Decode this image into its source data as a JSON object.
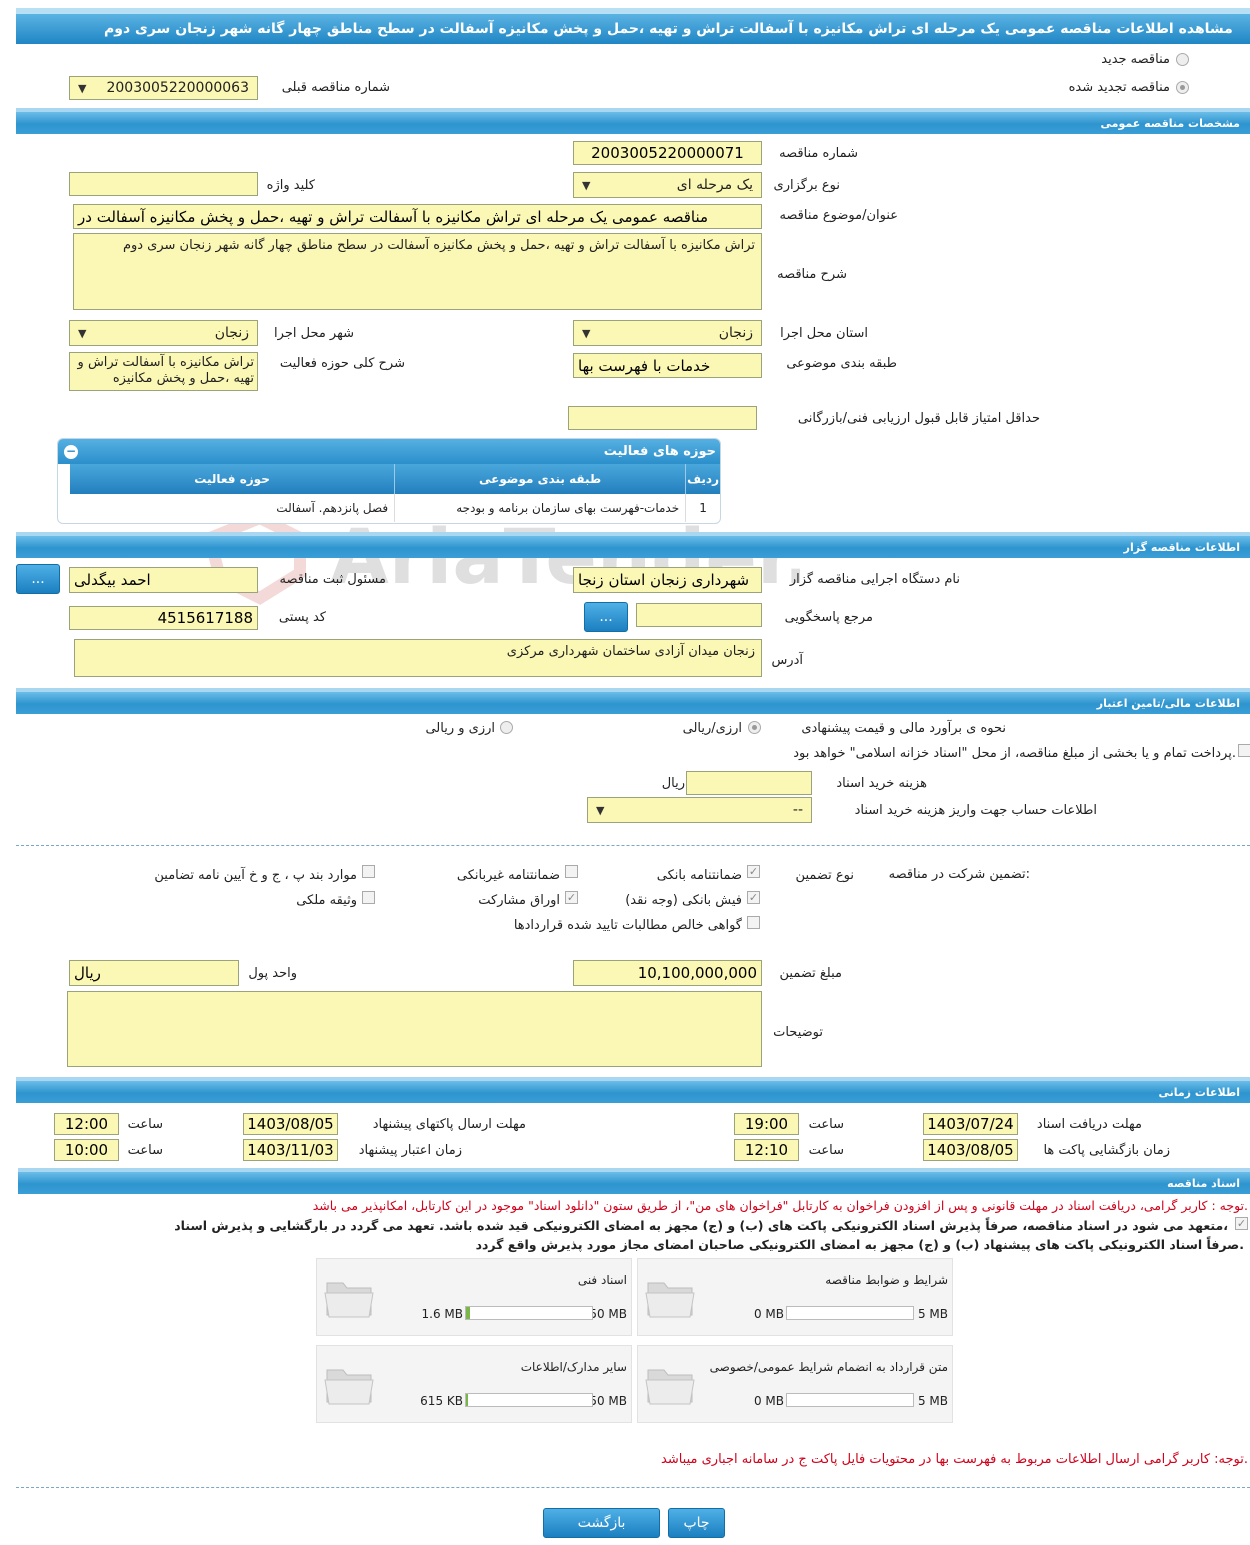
{
  "header": {
    "title": "مشاهده اطلاعات مناقصه عمومی یک مرحله ای تراش مکانیزه با آسفالت تراش و تهیه ،حمل و پخش مکانیزه آسفالت در سطح مناطق چهار گانه شهر زنجان سری دوم"
  },
  "top": {
    "radio_new": "مناقصه جدید",
    "radio_renewed": "مناقصه تجدید شده",
    "prev_number_label": "شماره مناقصه قبلی",
    "prev_number_value": "2003005220000063"
  },
  "general": {
    "section_title": "مشخصات مناقصه عمومی",
    "number_label": "شماره مناقصه",
    "number_value": "2003005220000071",
    "type_label": "نوع برگزاری",
    "type_value": "یک مرحله ای",
    "keyword_label": "کلید واژه",
    "keyword_value": "",
    "subject_label": "عنوان/موضوع مناقصه",
    "subject_value": "مناقصه عمومی یک مرحله ای تراش مکانیزه با آسفالت تراش و تهیه ،حمل و پخش مکانیزه آسفالت در",
    "desc_label": "شرح مناقصه",
    "desc_value": "تراش مکانیزه با آسفالت تراش و تهیه ،حمل و پخش مکانیزه آسفالت در سطح مناطق چهار گانه شهر زنجان سری دوم",
    "province_label": "استان محل اجرا",
    "province_value": "زنجان",
    "city_label": "شهر محل اجرا",
    "city_value": "زنجان",
    "category_label": "طبقه بندی موضوعی",
    "category_value": "خدمات با فهرست بها",
    "scope_label": "شرح کلی حوزه فعالیت",
    "scope_value": "تراش مکانیزه با آسفالت تراش و تهیه ،حمل و پخش مکانیزه",
    "min_score_label": "حداقل امتیاز قابل قبول ارزیابی فنی/بازرگانی",
    "min_score_value": ""
  },
  "activity_table": {
    "title": "حوزه های فعالیت",
    "headers": [
      "ردیف",
      "طبقه بندی موضوعی",
      "حوزه فعالیت"
    ],
    "rows": [
      [
        "1",
        "خدمات-فهرست بهای سازمان برنامه و بودجه",
        "فصل پانزدهم. آسفالت"
      ]
    ]
  },
  "organizer": {
    "section_title": "اطلاعات مناقصه گزار",
    "org_label": "نام دستگاه اجرایی مناقصه گزار",
    "org_value": "شهرداری زنجان استان زنجا",
    "responsible_label": "مسئول ثبت مناقصه",
    "responsible_value": "احمد بیگدلی",
    "ref_label": "مرجع پاسخگویی",
    "ref_value": "",
    "postal_label": "کد پستی",
    "postal_value": "4515617188",
    "address_label": "آدرس",
    "address_value": "زنجان میدان آزادی ساختمان شهرداری مرکزی",
    "dots": "..."
  },
  "finance": {
    "section_title": "اطلاعات مالی/تامین اعتبار",
    "estimate_label": "نحوه ی برآورد مالی و قیمت پیشنهادی",
    "opt_rial": "ارزی/ریالی",
    "opt_fx": "ارزی و ریالی",
    "islamic_note": "پرداخت تمام و یا بخشی از مبلغ مناقصه، از محل \"اسناد خزانه اسلامی\" خواهد بود.",
    "doc_cost_label": "هزینه خرید اسناد",
    "doc_cost_value": "",
    "doc_cost_unit": "ریال",
    "account_label": "اطلاعات حساب جهت واریز هزینه خرید اسناد",
    "account_value": "--"
  },
  "guarantee": {
    "label": "تضمین شرکت در مناقصه:",
    "type_label": "نوع تضمین",
    "options": {
      "bank_guarantee": "ضمانتنامه بانکی",
      "nonbank_guarantee": "ضمانتنامه غیربانکی",
      "bylaw_items": "موارد بند پ ، ج و خ آیین نامه تضامین",
      "bank_receipt": "فیش بانکی (وجه نقد)",
      "participation_bonds": "اوراق مشارکت",
      "property": "وثیقه ملکی",
      "receivables": "گواهی خالص مطالبات تایید شده قراردادها"
    },
    "amount_label": "مبلغ تضمین",
    "amount_value": "10,100,000,000",
    "currency_label": "واحد پول",
    "currency_value": "ریال",
    "notes_label": "توضیحات",
    "notes_value": ""
  },
  "timing": {
    "section_title": "اطلاعات زمانی",
    "receive_label": "مهلت دریافت اسناد",
    "receive_date": "1403/07/24",
    "receive_time": "19:00",
    "send_label": "مهلت ارسال پاکتهای پیشنهاد",
    "send_date": "1403/08/05",
    "send_time": "12:00",
    "open_label": "زمان بازگشایی پاکت ها",
    "open_date": "1403/08/05",
    "open_time": "12:10",
    "validity_label": "زمان اعتبار پیشنهاد",
    "validity_date": "1403/11/03",
    "validity_time": "10:00",
    "time_label": "ساعت"
  },
  "docs": {
    "section_title": "اسناد مناقصه",
    "note1": "توجه : کاربر گرامی، دریافت اسناد در مهلت قانونی و پس از افزودن فراخوان به کارتابل \"فراخوان های من\"، از طریق ستون \"دانلود اسناد\" موجود در این کارتابل، امکانپذیر می باشد.",
    "commit_line1": "متعهد می شود در اسناد مناقصه، صرفاً پذیرش اسناد الکترونیکی پاکت های (ب) و (ج) مجهز به امضای الکترونیکی قید شده باشد. تعهد می گردد در بارگشایی و پذیرش اسناد،",
    "commit_line2": "صرفاً اسناد الکترونیکی پاکت های پیشنهاد (ب) و (ج) مجهز به امضای الکترونیکی صاحبان امضای مجاز مورد پذیرش واقع گردد.",
    "cards": [
      {
        "title": "شرایط و ضوابط مناقصه",
        "size": "0 MB",
        "max": "5 MB",
        "fill": 0
      },
      {
        "title": "اسناد فنی",
        "size": "1.6 MB",
        "max": "50 MB",
        "fill": 0.032
      },
      {
        "title": "متن قرارداد به انضمام شرایط عمومی/خصوصی",
        "size": "0 MB",
        "max": "5 MB",
        "fill": 0
      },
      {
        "title": "سایر مدارک/اطلاعات",
        "size": "615 KB",
        "max": "50 MB",
        "fill": 0.012
      }
    ],
    "note2": "توجه: کاربر گرامی ارسال اطلاعات مربوط به فهرست بها در محتویات فایل پاکت ج در سامانه اجباری میباشد."
  },
  "buttons": {
    "print": "چاپ",
    "back": "بازگشت"
  },
  "watermark": "AriaTender.neT"
}
